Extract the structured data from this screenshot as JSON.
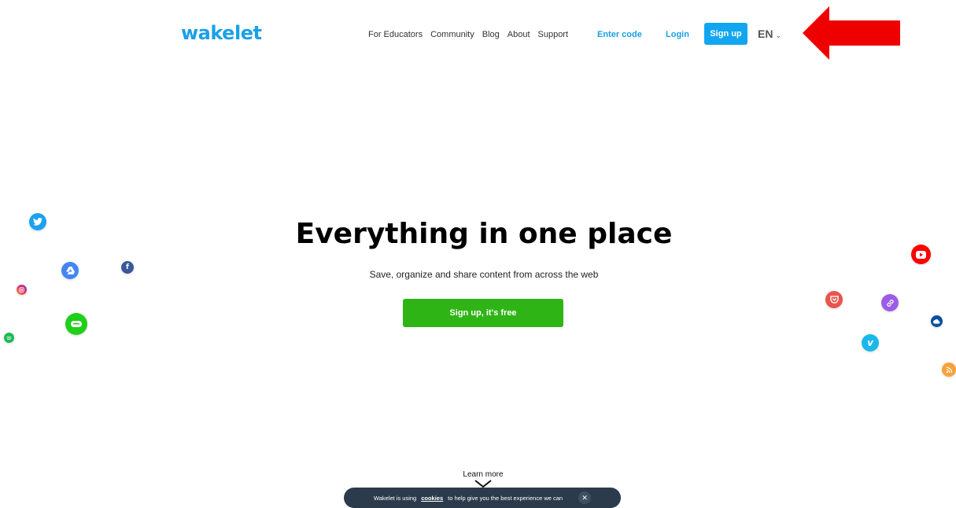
{
  "header": {
    "logo": "wakelet",
    "nav": [
      "For Educators",
      "Community",
      "Blog",
      "About",
      "Support"
    ],
    "enter_code": "Enter code",
    "login": "Login",
    "signup": "Sign up",
    "language": "EN"
  },
  "hero": {
    "title": "Everything in one place",
    "subtitle": "Save, organize and share content from across the web",
    "cta": "Sign up, it's free"
  },
  "learn_more": "Learn more",
  "cookie": {
    "text_before": "Wakelet is using",
    "link": "cookies",
    "text_after": "to help give you the best experience we can",
    "close": "✕"
  },
  "icons": [
    "twitter-icon",
    "google-drive-icon",
    "facebook-icon",
    "instagram-icon",
    "spotify-icon",
    "evernote-icon",
    "youtube-icon",
    "pocket-icon",
    "link-icon",
    "onedrive-icon",
    "vimeo-icon",
    "rss-icon"
  ],
  "colors": {
    "brand": "#1aa0e8",
    "signup_button": "#12a6f0",
    "cta_button": "#2fb415",
    "annotation_arrow": "#ee0000",
    "cookie_banner": "#2b3b4b"
  }
}
